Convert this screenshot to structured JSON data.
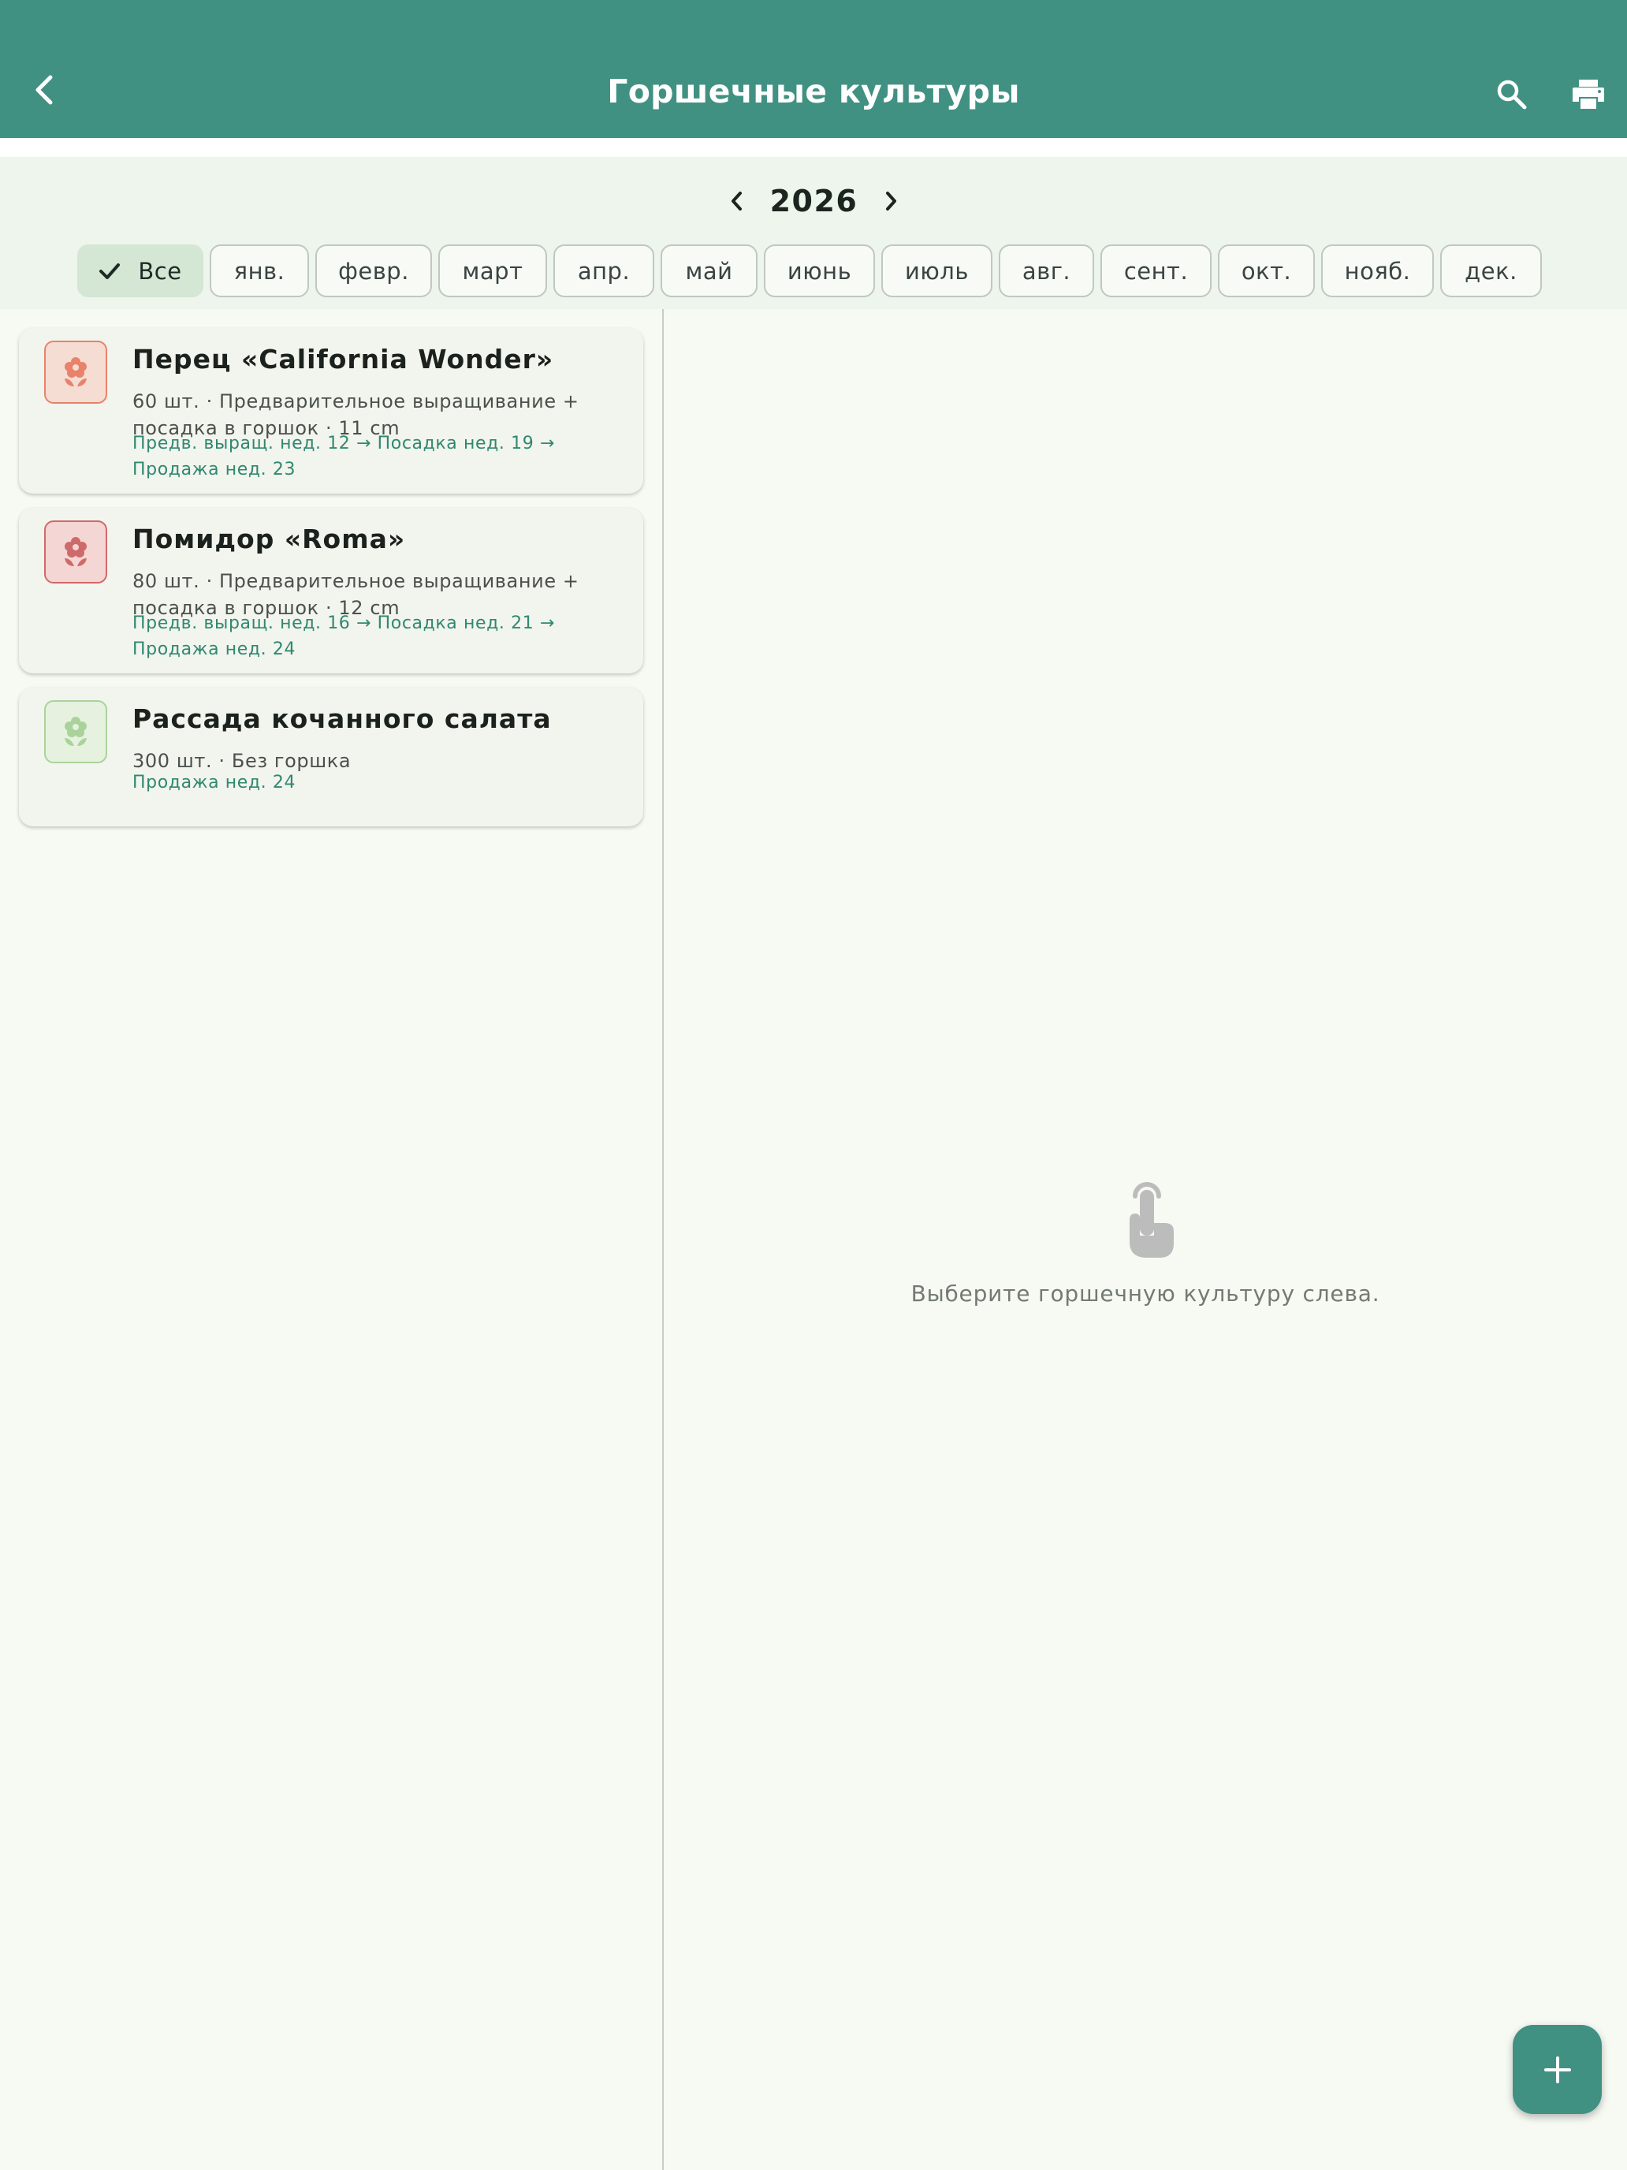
{
  "appbar": {
    "title": "Горшечные культуры",
    "back_icon": "chevron-left-icon",
    "search_icon": "search-icon",
    "print_icon": "printer-icon"
  },
  "year_nav": {
    "year": "2026"
  },
  "months": {
    "all": "Все",
    "jan": "янв.",
    "feb": "февр.",
    "mar": "март",
    "apr": "апр.",
    "may": "май",
    "jun": "июнь",
    "jul": "июль",
    "aug": "авг.",
    "sep": "сент.",
    "oct": "окт.",
    "nov": "нояб.",
    "dec": "дек.",
    "selected": "Все"
  },
  "crops": [
    {
      "name": "Перец «California Wonder»",
      "desc": "60 шт. · Предварительное выращивание + посадка в горшок · 11 cm",
      "schedule": "Предв. выращ. нед. 12 → Посадка нед. 19 → Продажа нед. 23",
      "color": "#e8826a"
    },
    {
      "name": "Помидор «Roma»",
      "desc": "80 шт. · Предварительное выращивание + посадка в горшок · 12 cm",
      "schedule": "Предв. выращ. нед. 16 → Посадка нед. 21 → Продажа нед. 24",
      "color": "#cf6a6a"
    },
    {
      "name": "Рассада кочанного салата",
      "desc": "300 шт. · Без горшка",
      "schedule": "Продажа нед. 24",
      "color": "#a9d39a"
    }
  ],
  "detail": {
    "empty_text": "Выберите горшечную культуру слева.",
    "empty_icon": "touch-icon"
  },
  "fab": {
    "icon": "plus-icon"
  },
  "colors": {
    "primary": "#419183",
    "background": "#f7faf3",
    "filter_bg": "#edf5ec",
    "chip_selected": "#d3e7d4",
    "schedule_text": "#2f8870"
  }
}
